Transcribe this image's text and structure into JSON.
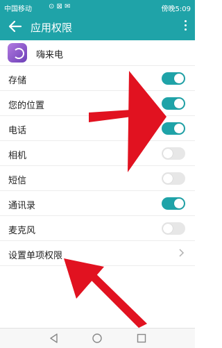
{
  "status_bar": {
    "carrier": "中国移动",
    "icons": "⊙ ⊠ ✉",
    "right": "傍晚5:09"
  },
  "app_bar": {
    "title": "应用权限"
  },
  "app": {
    "name": "嗨来电"
  },
  "permissions": [
    {
      "label": "存储",
      "on": true
    },
    {
      "label": "您的位置",
      "on": true
    },
    {
      "label": "电话",
      "on": true
    },
    {
      "label": "相机",
      "on": false
    },
    {
      "label": "短信",
      "on": false
    },
    {
      "label": "通讯录",
      "on": true
    },
    {
      "label": "麦克风",
      "on": false
    }
  ],
  "single_permission": {
    "label": "设置单项权限"
  },
  "colors": {
    "accent": "#1fa3a8",
    "arrow": "#e11220"
  }
}
